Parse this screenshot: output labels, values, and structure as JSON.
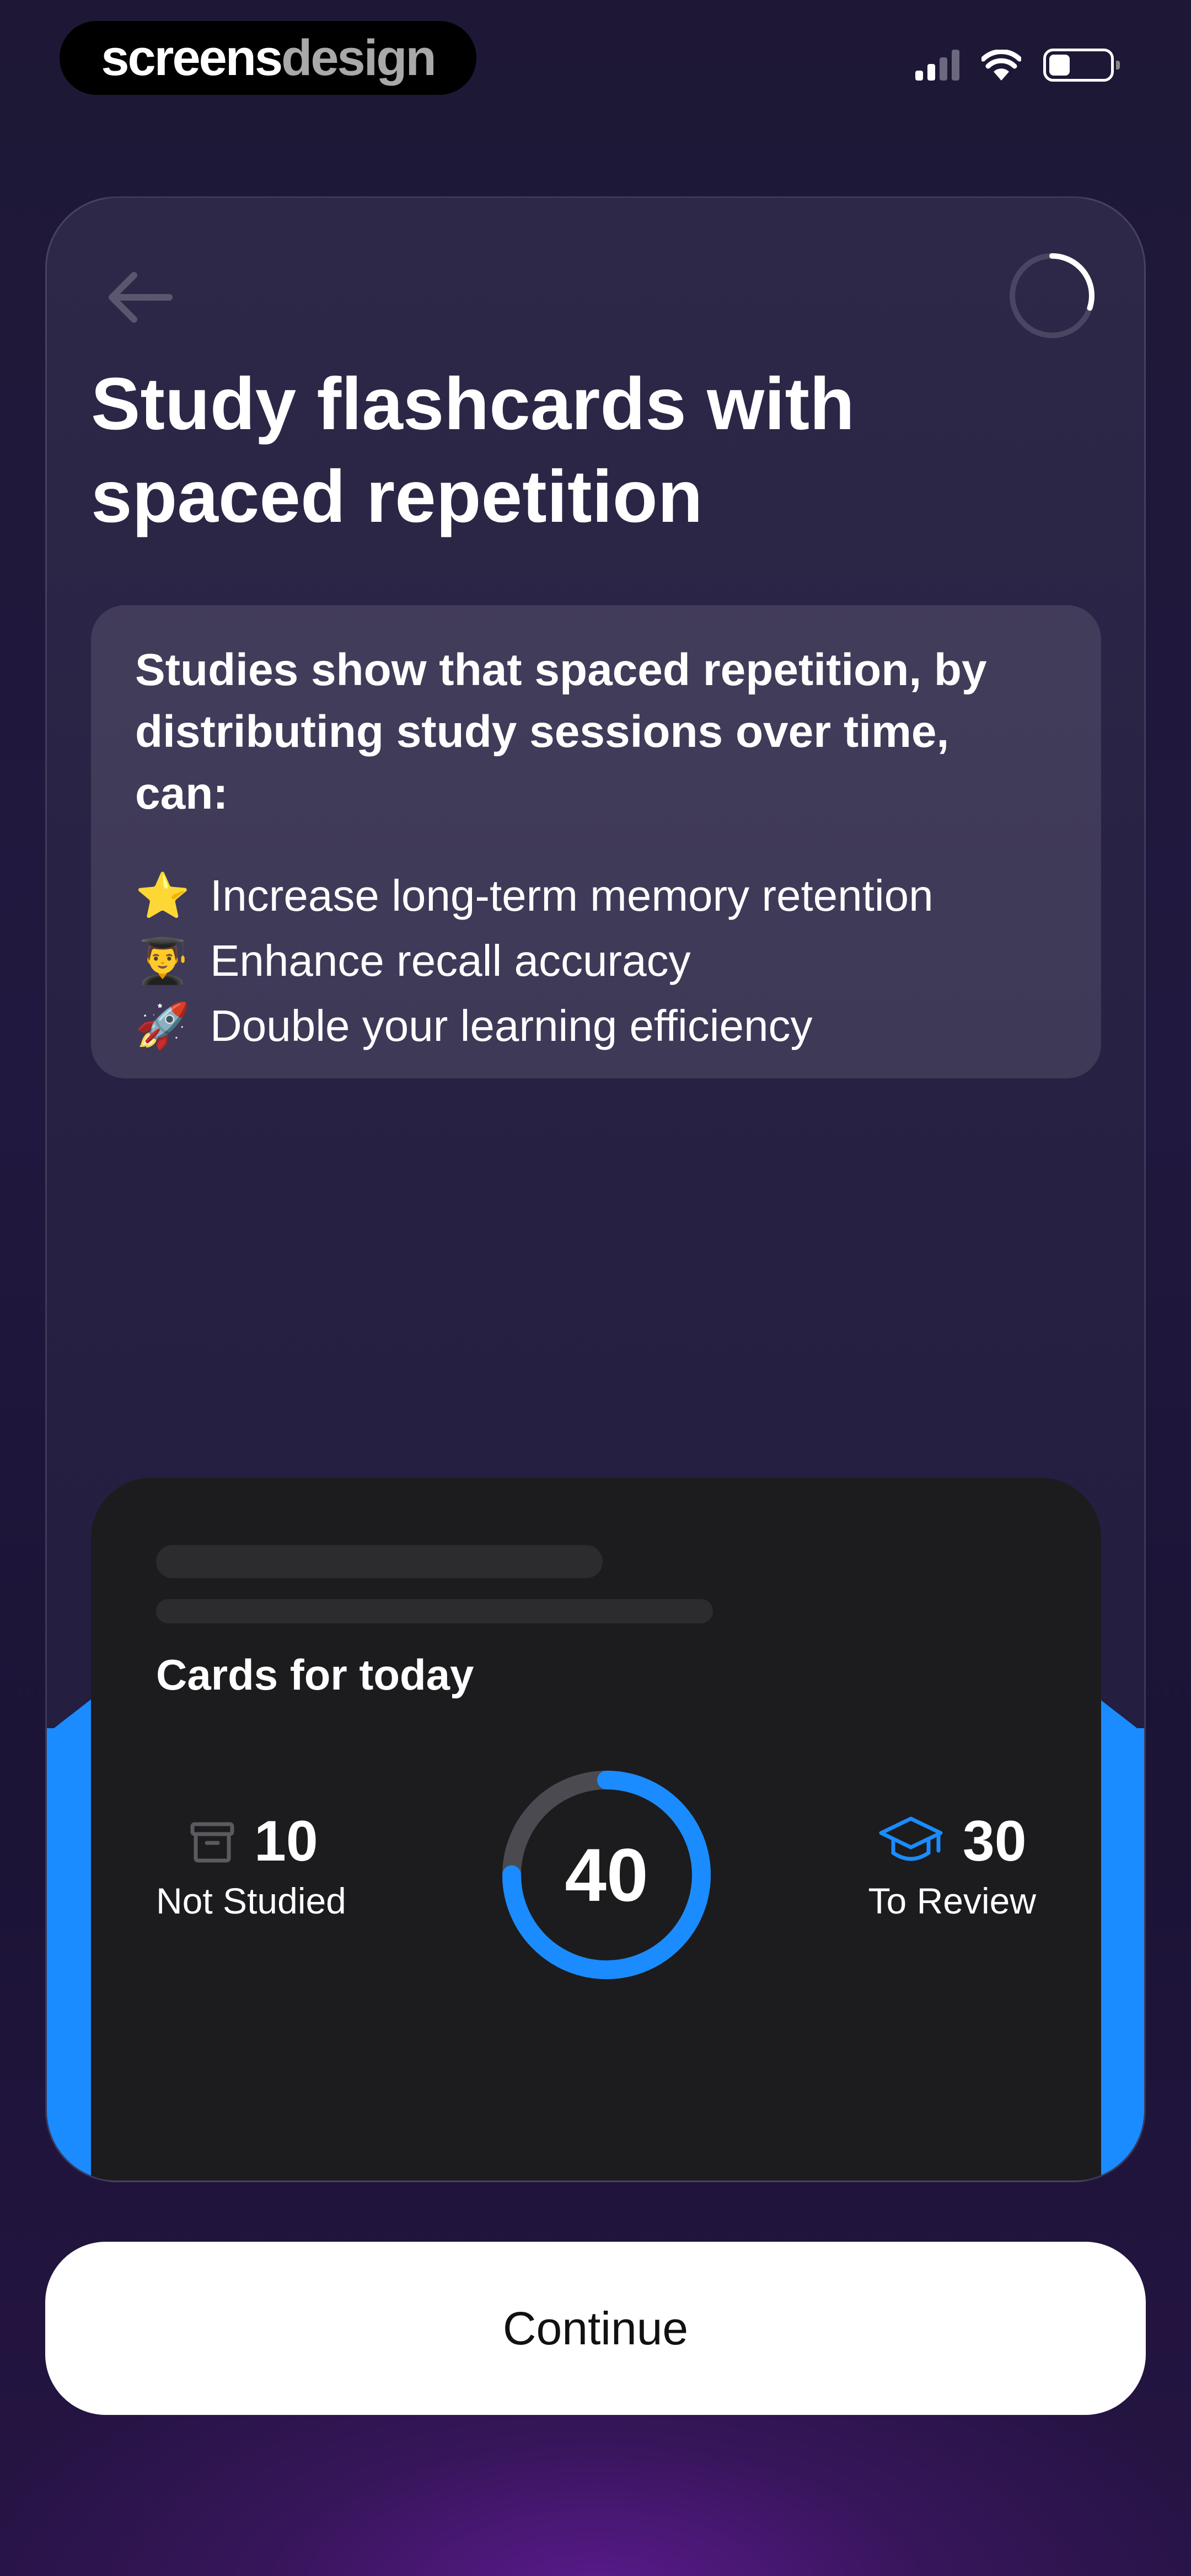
{
  "watermark": {
    "part1": "screens",
    "part2": "design"
  },
  "status_bar": {
    "signal_icon": "cellular-signal-icon",
    "wifi_icon": "wifi-icon",
    "battery_icon": "battery-icon",
    "battery_level": 0.35
  },
  "header": {
    "back_icon": "arrow-left-icon",
    "progress_icon": "progress-ring-icon",
    "progress": 0.3
  },
  "title": "Study flashcards with spaced repetition",
  "info": {
    "intro": "Studies show that spaced repetition, by distributing study sessions over time, can:",
    "benefits": [
      {
        "emoji": "⭐",
        "text": "Increase long-term memory retention"
      },
      {
        "emoji": "👨‍🎓",
        "text": "Enhance recall accuracy"
      },
      {
        "emoji": "🚀",
        "text": "Double your learning efficiency"
      }
    ]
  },
  "widget": {
    "title": "Cards for today",
    "total": "40",
    "not_studied": {
      "value": "10",
      "label": "Not Studied",
      "icon": "archive-box-icon"
    },
    "to_review": {
      "value": "30",
      "label": "To Review",
      "icon": "graduation-cap-icon"
    },
    "donut_fraction": 0.75
  },
  "colors": {
    "accent": "#1a8cff",
    "card_bg": "#1c1c1e",
    "background": "#1e1836"
  },
  "continue_label": "Continue"
}
